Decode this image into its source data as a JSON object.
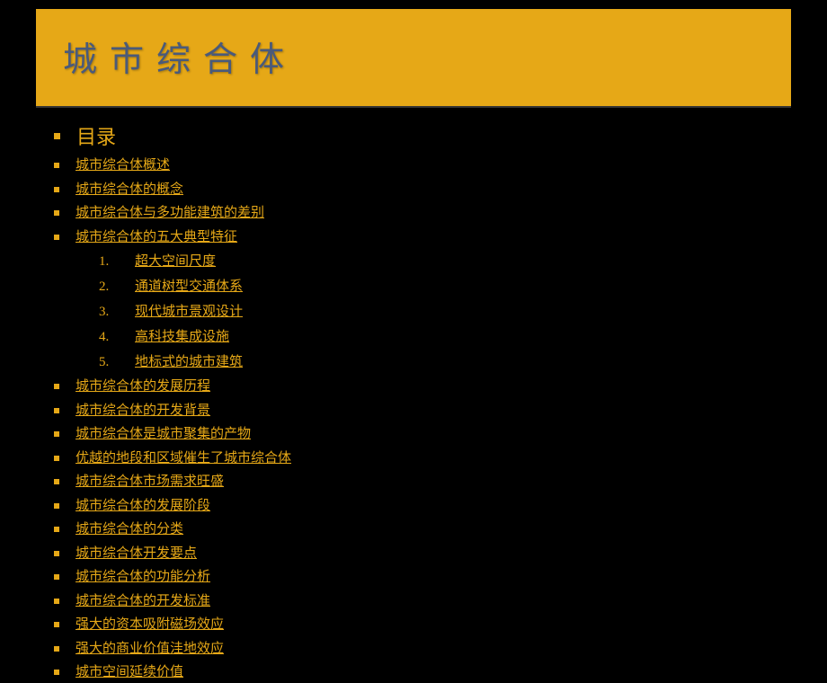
{
  "title": "城市综合体",
  "toc_heading": "目录",
  "toc_items": [
    {
      "label": "城市综合体概述"
    },
    {
      "label": "城市综合体的概念"
    },
    {
      "label": "城市综合体与多功能建筑的差别"
    },
    {
      "label": "城市综合体的五大典型特征",
      "subitems": [
        {
          "num": "1.",
          "label": "超大空间尺度"
        },
        {
          "num": "2.",
          "label": "通道树型交通体系"
        },
        {
          "num": "3.",
          "label": "现代城市景观设计"
        },
        {
          "num": "4.",
          "label": "高科技集成设施"
        },
        {
          "num": "5.",
          "label": "地标式的城市建筑"
        }
      ]
    },
    {
      "label": "城市综合体的发展历程"
    },
    {
      "label": "城市综合体的开发背景"
    },
    {
      "label": "城市综合体是城市聚集的产物"
    },
    {
      "label": "优越的地段和区域催生了城市综合体"
    },
    {
      "label": "城市综合体市场需求旺盛"
    },
    {
      "label": "城市综合体的发展阶段"
    },
    {
      "label": "城市综合体的分类"
    },
    {
      "label": "城市综合体开发要点"
    },
    {
      "label": "城市综合体的功能分析"
    },
    {
      "label": "城市综合体的开发标准"
    },
    {
      "label": "强大的资本吸附磁场效应"
    },
    {
      "label": "强大的商业价值洼地效应"
    },
    {
      "label": "城市空间延续价值"
    }
  ]
}
